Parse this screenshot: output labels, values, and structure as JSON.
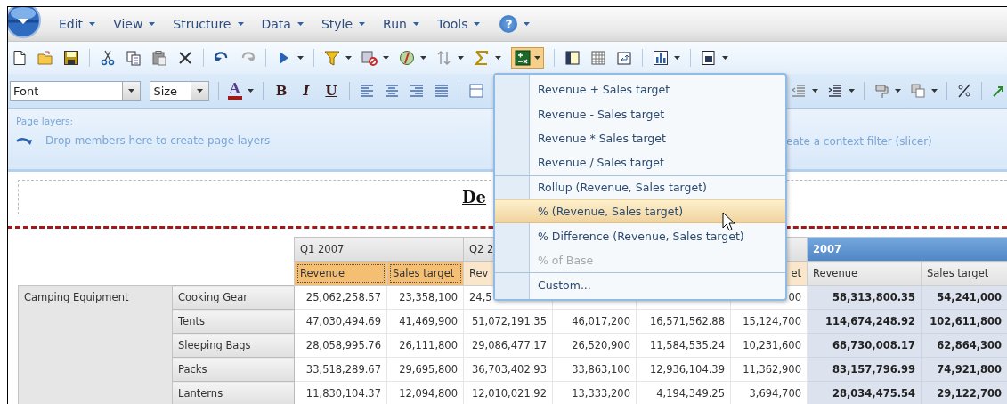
{
  "menu_bar": {
    "items": [
      {
        "label": "Edit"
      },
      {
        "label": "View"
      },
      {
        "label": "Structure"
      },
      {
        "label": "Data"
      },
      {
        "label": "Style"
      },
      {
        "label": "Run"
      },
      {
        "label": "Tools"
      }
    ],
    "help_label": "?"
  },
  "toolbar": {
    "calculation_expanded": true
  },
  "format_bar": {
    "font": "Font",
    "size": "Size",
    "font_color_label": "A",
    "style_buttons": [
      {
        "label": "B",
        "kind": "bold"
      },
      {
        "label": "I",
        "kind": "italic"
      },
      {
        "label": "U",
        "kind": "underline"
      }
    ]
  },
  "page_layers": {
    "title": "Page layers:",
    "hint": "Drop members here to create page layers"
  },
  "context_filter": {
    "hint": "eate a context filter (slicer)"
  },
  "report": {
    "title": "De"
  },
  "table": {
    "column_groups": [
      {
        "label": "Q1 2007",
        "kind": "quarter",
        "measures": [
          {
            "label": "Revenue",
            "kind": "revenue",
            "selected": true
          },
          {
            "label": "Sales target",
            "kind": "sales_target",
            "selected": true
          }
        ]
      },
      {
        "label": "Q2 2",
        "kind": "quarter",
        "measures": [
          {
            "label": "Rev",
            "kind": "revenue",
            "selected": false
          }
        ]
      },
      {
        "kind": "quarter",
        "measures": [
          {
            "label": "et",
            "kind": "sales_target",
            "selected": false
          }
        ]
      },
      {
        "label": "2007",
        "kind": "year",
        "measures": [
          {
            "label": "Revenue",
            "kind": "revenue",
            "selected": false
          },
          {
            "label": "Sales target",
            "kind": "sales_target",
            "selected": false
          }
        ]
      }
    ],
    "row_groups": [
      {
        "label": "Camping Equipment",
        "rows": [
          {
            "label": "Cooking Gear",
            "cells": [
              "25,062,258.57",
              "23,358,100",
              "24,5",
              null,
              null,
              "00",
              "58,313,800.35",
              "54,241,000"
            ]
          },
          {
            "label": "Tents",
            "cells": [
              "47,030,494.69",
              "41,469,900",
              "51,072,191.35",
              "46,017,200",
              "16,571,562.88",
              "15,124,700",
              "114,674,248.92",
              "102,611,800"
            ]
          },
          {
            "label": "Sleeping Bags",
            "cells": [
              "28,058,995.76",
              "26,111,800",
              "29,086,477.17",
              "26,520,900",
              "11,584,535.24",
              "10,231,600",
              "68,730,008.17",
              "62,864,300"
            ]
          },
          {
            "label": "Packs",
            "cells": [
              "33,518,289.67",
              "29,695,800",
              "36,703,402.93",
              "33,863,100",
              "12,936,104.39",
              "11,362,900",
              "83,157,796.99",
              "74,921,800"
            ]
          },
          {
            "label": "Lanterns",
            "cells": [
              "11,830,104.37",
              "12,094,800",
              "12,010,021.92",
              "13,333,200",
              "4,194,349.25",
              "3,694,700",
              "28,034,475.54",
              "29,122,700"
            ]
          }
        ]
      }
    ]
  },
  "calc_menu": {
    "items": [
      {
        "label": "Revenue + Sales target",
        "selected": false,
        "disabled": false,
        "separator_before": false
      },
      {
        "label": "Revenue - Sales target",
        "selected": false,
        "disabled": false,
        "separator_before": false
      },
      {
        "label": "Revenue * Sales target",
        "selected": false,
        "disabled": false,
        "separator_before": false
      },
      {
        "label": "Revenue / Sales target",
        "selected": false,
        "disabled": false,
        "separator_before": false
      },
      {
        "label": "Rollup (Revenue, Sales target)",
        "selected": false,
        "disabled": false,
        "separator_before": true
      },
      {
        "label": "% (Revenue, Sales target)",
        "selected": true,
        "disabled": false,
        "separator_before": false
      },
      {
        "label": "% Difference (Revenue, Sales target)",
        "selected": false,
        "disabled": false,
        "separator_before": false
      },
      {
        "label": "% of Base",
        "selected": false,
        "disabled": true,
        "separator_before": false
      },
      {
        "label": "Custom...",
        "selected": false,
        "disabled": false,
        "separator_before": true
      }
    ]
  }
}
